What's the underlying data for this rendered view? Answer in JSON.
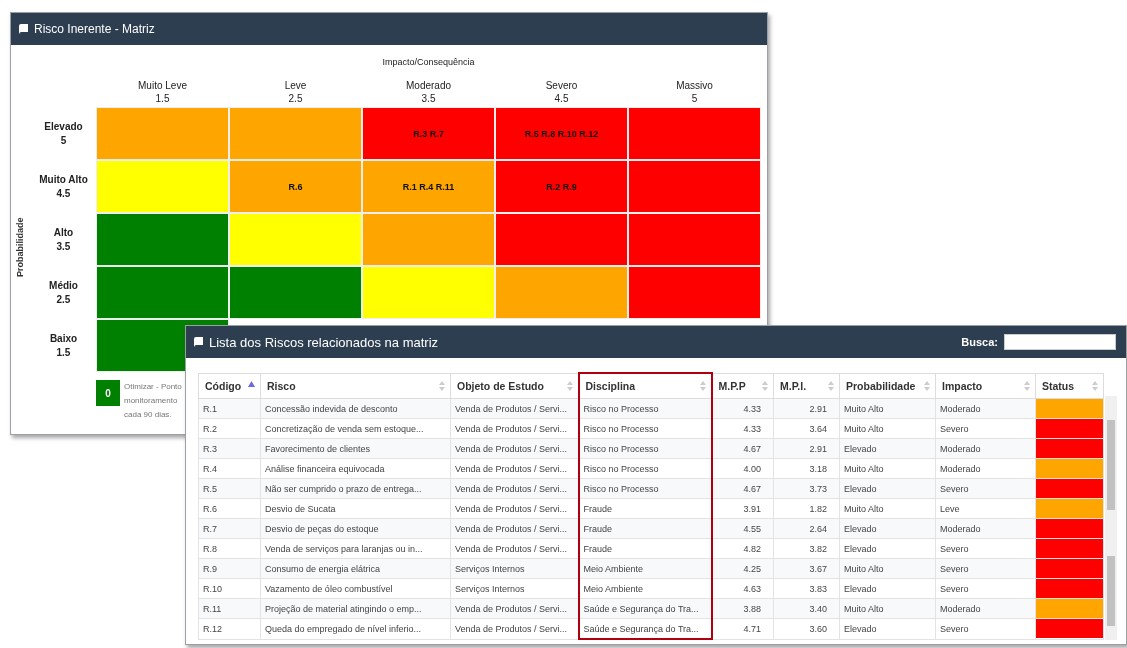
{
  "matrix_window": {
    "title": "Risco Inerente - Matriz",
    "x_axis_title": "Impacto/Consequência",
    "y_axis_title": "Probabilidade",
    "columns": [
      {
        "name": "Muito Leve",
        "value": "1.5"
      },
      {
        "name": "Leve",
        "value": "2.5"
      },
      {
        "name": "Moderado",
        "value": "3.5"
      },
      {
        "name": "Severo",
        "value": "4.5"
      },
      {
        "name": "Massivo",
        "value": "5"
      }
    ],
    "rows": [
      {
        "name": "Elevado",
        "value": "5",
        "cells": [
          {
            "color": "#ffa500",
            "text": ""
          },
          {
            "color": "#ffa500",
            "text": ""
          },
          {
            "color": "#ff0000",
            "text": "R.3 R.7"
          },
          {
            "color": "#ff0000",
            "text": "R.5 R.8 R.10 R.12"
          },
          {
            "color": "#ff0000",
            "text": ""
          }
        ]
      },
      {
        "name": "Muito Alto",
        "value": "4.5",
        "cells": [
          {
            "color": "#ffff00",
            "text": ""
          },
          {
            "color": "#ffa500",
            "text": "R.6"
          },
          {
            "color": "#ffa500",
            "text": "R.1 R.4 R.11"
          },
          {
            "color": "#ff0000",
            "text": "R.2 R.9"
          },
          {
            "color": "#ff0000",
            "text": ""
          }
        ]
      },
      {
        "name": "Alto",
        "value": "3.5",
        "cells": [
          {
            "color": "#008000",
            "text": ""
          },
          {
            "color": "#ffff00",
            "text": ""
          },
          {
            "color": "#ffa500",
            "text": ""
          },
          {
            "color": "#ff0000",
            "text": ""
          },
          {
            "color": "#ff0000",
            "text": ""
          }
        ]
      },
      {
        "name": "Médio",
        "value": "2.5",
        "cells": [
          {
            "color": "#008000",
            "text": ""
          },
          {
            "color": "#008000",
            "text": ""
          },
          {
            "color": "#ffff00",
            "text": ""
          },
          {
            "color": "#ffa500",
            "text": ""
          },
          {
            "color": "#ff0000",
            "text": ""
          }
        ]
      },
      {
        "name": "Baixo",
        "value": "1.5",
        "cells": [
          {
            "color": "#008000",
            "text": ""
          }
        ]
      }
    ],
    "legend": [
      {
        "color": "#008000",
        "count": "0",
        "text": "Otimizar - Ponto monitoramento cada 90 dias."
      }
    ]
  },
  "list_window": {
    "title": "Lista dos Riscos relacionados na matriz",
    "search": {
      "label": "Busca:"
    },
    "columns": [
      {
        "label": "Código",
        "sorted": true
      },
      {
        "label": "Risco",
        "sorted": false
      },
      {
        "label": "Objeto de Estudo",
        "sorted": false
      },
      {
        "label": "Disciplina",
        "sorted": false,
        "highlighted": true
      },
      {
        "label": "M.P.P",
        "sorted": false
      },
      {
        "label": "M.P.I.",
        "sorted": false
      },
      {
        "label": "Probabilidade",
        "sorted": false
      },
      {
        "label": "Impacto",
        "sorted": false
      },
      {
        "label": "Status",
        "sorted": false
      }
    ],
    "rows": [
      {
        "cells": [
          "R.1",
          "Concessão indevida de desconto",
          "Venda de Produtos / Servi...",
          "Risco no Processo",
          "4.33",
          "2.91",
          "Muito Alto",
          "Moderado"
        ],
        "color": "#ffa500"
      },
      {
        "cells": [
          "R.2",
          "Concretização de venda sem estoque...",
          "Venda de Produtos / Servi...",
          "Risco no Processo",
          "4.33",
          "3.64",
          "Muito Alto",
          "Severo"
        ],
        "color": "#ff0000"
      },
      {
        "cells": [
          "R.3",
          "Favorecimento de clientes",
          "Venda de Produtos / Servi...",
          "Risco no Processo",
          "4.67",
          "2.91",
          "Elevado",
          "Moderado"
        ],
        "color": "#ff0000"
      },
      {
        "cells": [
          "R.4",
          "Análise financeira equivocada",
          "Venda de Produtos / Servi...",
          "Risco no Processo",
          "4.00",
          "3.18",
          "Muito Alto",
          "Moderado"
        ],
        "color": "#ffa500"
      },
      {
        "cells": [
          "R.5",
          "Não ser cumprido o prazo de entrega...",
          "Venda de Produtos / Servi...",
          "Risco no Processo",
          "4.67",
          "3.73",
          "Elevado",
          "Severo"
        ],
        "color": "#ff0000"
      },
      {
        "cells": [
          "R.6",
          "Desvio de Sucata",
          "Venda de Produtos / Servi...",
          "Fraude",
          "3.91",
          "1.82",
          "Muito Alto",
          "Leve"
        ],
        "color": "#ffa500"
      },
      {
        "cells": [
          "R.7",
          "Desvio de peças do estoque",
          "Venda de Produtos / Servi...",
          "Fraude",
          "4.55",
          "2.64",
          "Elevado",
          "Moderado"
        ],
        "color": "#ff0000"
      },
      {
        "cells": [
          "R.8",
          "Venda de serviços para laranjas ou in...",
          "Venda de Produtos / Servi...",
          "Fraude",
          "4.82",
          "3.82",
          "Elevado",
          "Severo"
        ],
        "color": "#ff0000"
      },
      {
        "cells": [
          "R.9",
          "Consumo de energia elátrica",
          "Serviços Internos",
          "Meio Ambiente",
          "4.25",
          "3.67",
          "Muito Alto",
          "Severo"
        ],
        "color": "#ff0000"
      },
      {
        "cells": [
          "R.10",
          "Vazamento de óleo combustível",
          "Serviços Internos",
          "Meio Ambiente",
          "4.63",
          "3.83",
          "Elevado",
          "Severo"
        ],
        "color": "#ff0000"
      },
      {
        "cells": [
          "R.11",
          "Projeção de material atingindo o emp...",
          "Venda de Produtos / Servi...",
          "Saúde e Segurança do Tra...",
          "3.88",
          "3.40",
          "Muito Alto",
          "Moderado"
        ],
        "color": "#ffa500"
      },
      {
        "cells": [
          "R.12",
          "Queda do empregado de nível inferio...",
          "Venda de Produtos / Servi...",
          "Saúde e Segurança do Tra...",
          "4.71",
          "3.60",
          "Elevado",
          "Severo"
        ],
        "color": "#ff0000"
      }
    ]
  }
}
